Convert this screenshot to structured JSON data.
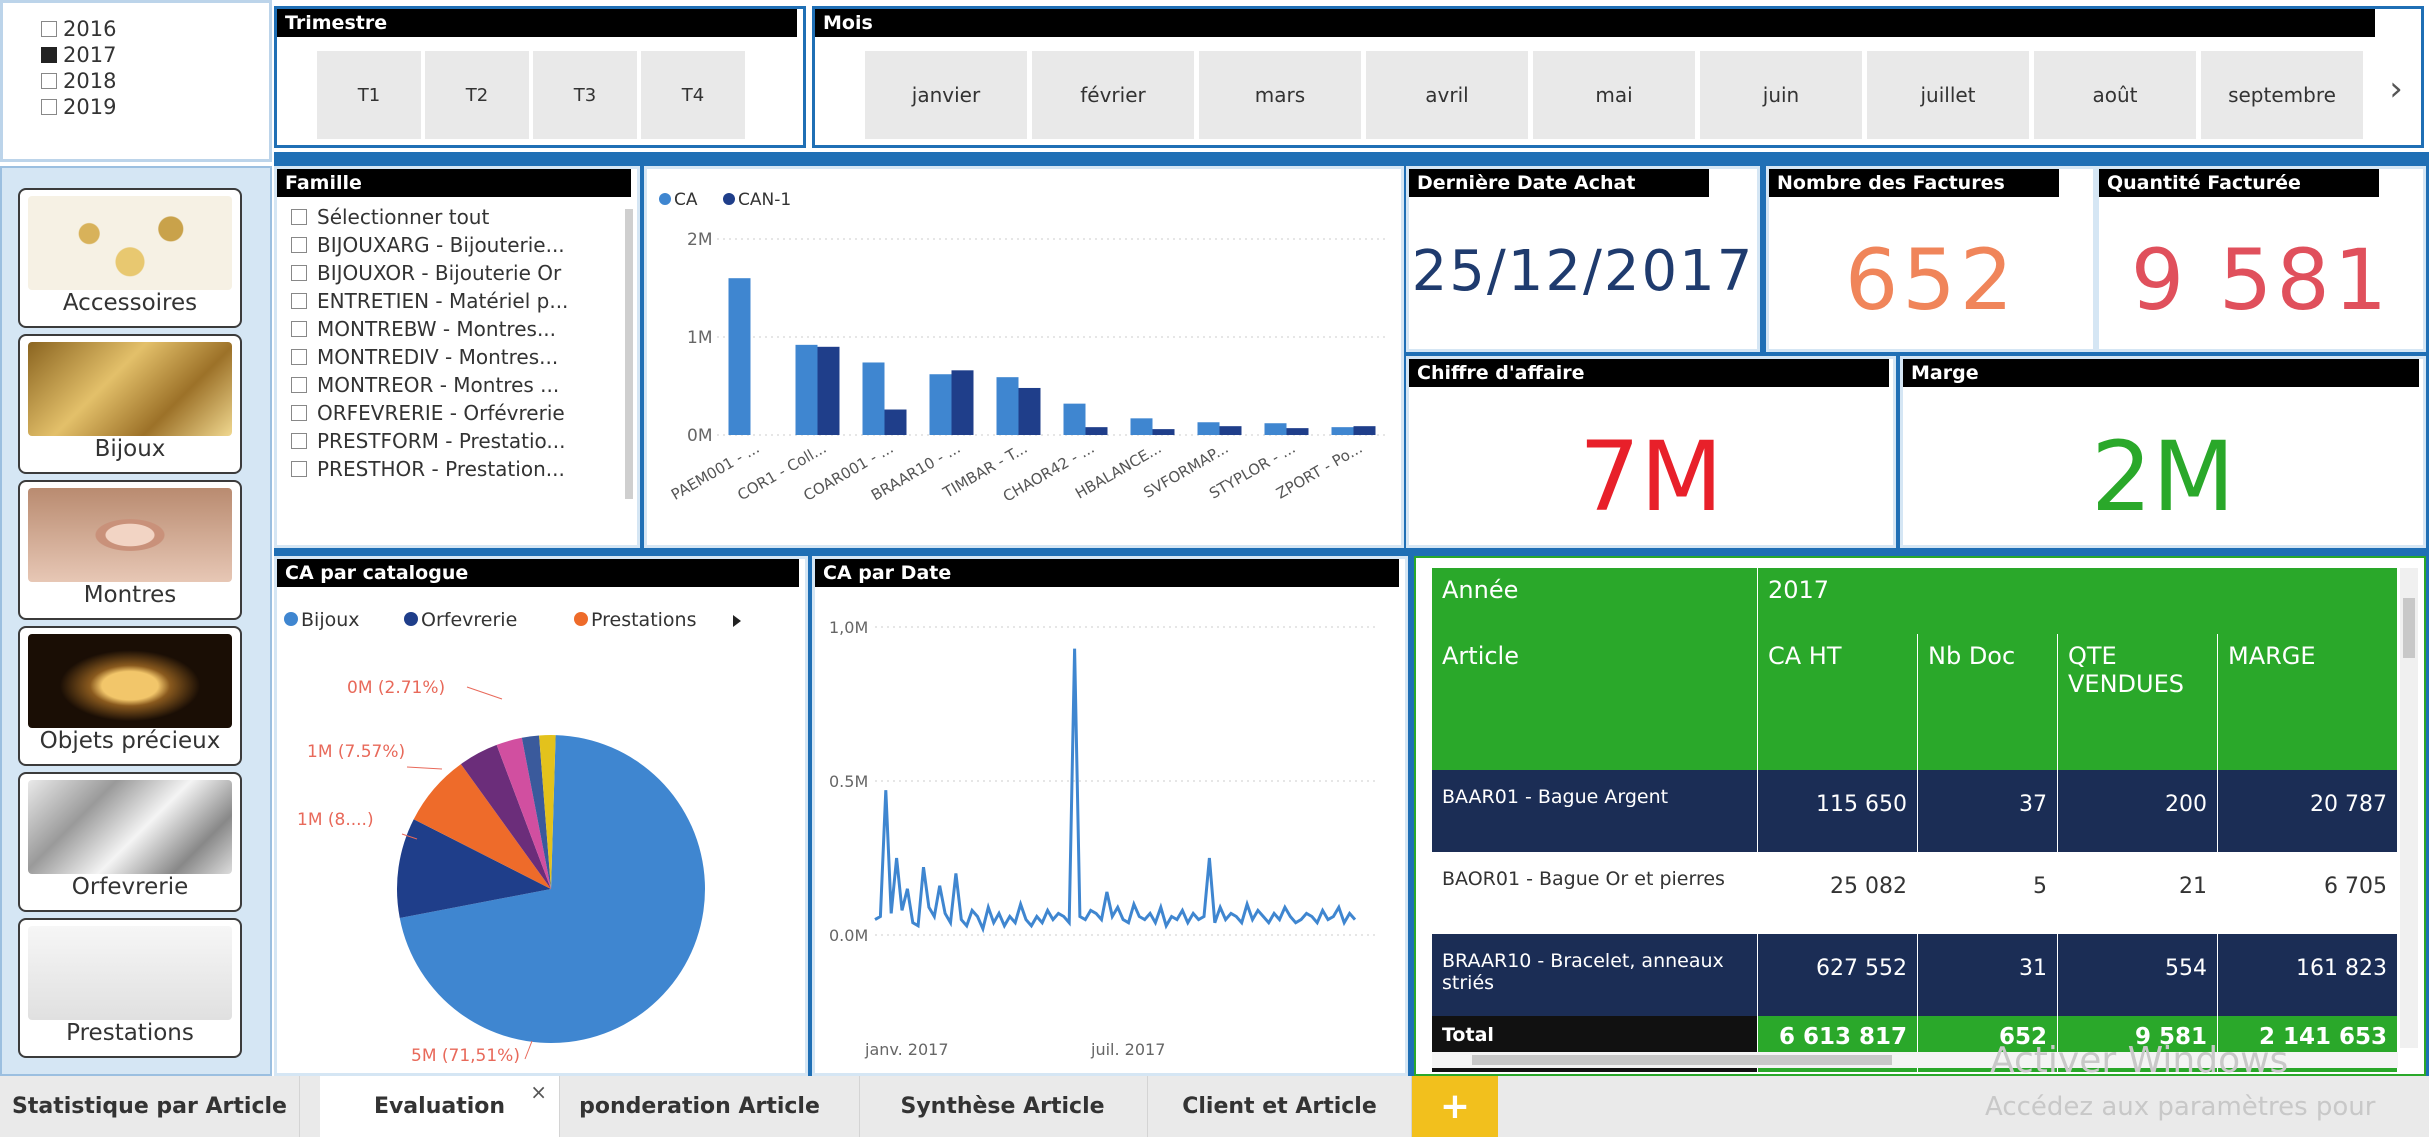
{
  "years": {
    "items": [
      {
        "label": "2016",
        "checked": false
      },
      {
        "label": "2017",
        "checked": true
      },
      {
        "label": "2018",
        "checked": false
      },
      {
        "label": "2019",
        "checked": false
      }
    ]
  },
  "trimestre": {
    "title": "Trimestre",
    "items": [
      "T1",
      "T2",
      "T3",
      "T4"
    ]
  },
  "mois": {
    "title": "Mois",
    "items": [
      "janvier",
      "février",
      "mars",
      "avril",
      "mai",
      "juin",
      "juillet",
      "août",
      "septembre"
    ],
    "next_icon": "chevron-right-icon"
  },
  "categories": [
    {
      "label": "Accessoires",
      "icon": "accessories-image"
    },
    {
      "label": "Bijoux",
      "icon": "jewelry-image"
    },
    {
      "label": "Montres",
      "icon": "watch-image"
    },
    {
      "label": "Objets précieux",
      "icon": "precious-objects-image"
    },
    {
      "label": "Orfevrerie",
      "icon": "silverware-image"
    },
    {
      "label": "Prestations",
      "icon": "services-image"
    }
  ],
  "famille": {
    "title": "Famille",
    "items": [
      "Sélectionner tout",
      "BIJOUXARG - Bijouterie...",
      "BIJOUXOR - Bijouterie Or",
      "ENTRETIEN - Matériel p...",
      "MONTREBW - Montres...",
      "MONTREDIV - Montres...",
      "MONTREOR - Montres ...",
      "ORFEVRERIE - Orfévrerie",
      "PRESTFORM - Prestatio...",
      "PRESTHOR - Prestation..."
    ]
  },
  "kpis": {
    "last_date": {
      "title": "Dernière Date Achat",
      "value": "25/12/2017",
      "color": "#1f3b6e"
    },
    "invoices": {
      "title": "Nombre des Factures",
      "value": "652",
      "color": "#f0855a"
    },
    "qty": {
      "title": "Quantité Facturée",
      "value": "9 581",
      "color": "#e0505c"
    },
    "revenue": {
      "title": "Chiffre d'affaire",
      "value": "7M",
      "color": "#e8202a"
    },
    "margin": {
      "title": "Marge",
      "value": "2M",
      "color": "#2aa82a"
    }
  },
  "chart_data": [
    {
      "type": "bar",
      "title": "",
      "legend": [
        "CA",
        "CAN-1"
      ],
      "colors": [
        "#3f86d0",
        "#1f3e8a"
      ],
      "yticks": [
        "2M",
        "1M",
        "0M"
      ],
      "ylim": [
        0,
        2000000
      ],
      "categories": [
        "PAEM001 - ...",
        "COR1 - Coll...",
        "COAR001 - ...",
        "BRAAR10 - ...",
        "TIMBAR - T...",
        "CHAOR42 - ...",
        "HBALANCE...",
        "SVFORMAP...",
        "STYPLOR - ...",
        "ZPORT - Po..."
      ],
      "series": [
        {
          "name": "CA",
          "values": [
            1600000,
            920000,
            740000,
            620000,
            590000,
            320000,
            170000,
            130000,
            120000,
            80000
          ]
        },
        {
          "name": "CAN-1",
          "values": [
            0,
            900000,
            260000,
            660000,
            480000,
            80000,
            60000,
            90000,
            70000,
            90000
          ]
        }
      ]
    },
    {
      "type": "pie",
      "title": "CA par catalogue",
      "legend": [
        "Bijoux",
        "Orfevrerie",
        "Prestations"
      ],
      "colors": [
        "#3f86d0",
        "#1f3e8a",
        "#ee6b2a",
        "#6b2d7a",
        "#d14fa0",
        "#3a5a9c",
        "#e3c21c"
      ],
      "values": [
        71.51,
        10.5,
        7.57,
        4.2,
        2.71,
        1.8,
        1.71
      ],
      "labels": [
        "5M (71,51%)",
        "1M (8....)",
        "1M (7.57%)",
        "0M (2.71%)"
      ]
    },
    {
      "type": "line",
      "title": "CA par Date",
      "yticks": [
        "1,0M",
        "0.5M",
        "0.0M"
      ],
      "ylim": [
        0,
        1000000
      ],
      "xticks": [
        "janv. 2017",
        "juil. 2017"
      ],
      "color": "#3f86d0",
      "values": [
        50000,
        60000,
        470000,
        70000,
        250000,
        80000,
        150000,
        40000,
        30000,
        220000,
        90000,
        60000,
        160000,
        70000,
        40000,
        200000,
        50000,
        30000,
        80000,
        60000,
        20000,
        90000,
        40000,
        70000,
        30000,
        60000,
        40000,
        100000,
        50000,
        30000,
        60000,
        40000,
        80000,
        50000,
        70000,
        60000,
        40000,
        930000,
        60000,
        50000,
        80000,
        70000,
        50000,
        140000,
        60000,
        90000,
        50000,
        40000,
        100000,
        60000,
        50000,
        70000,
        40000,
        90000,
        30000,
        60000,
        50000,
        80000,
        40000,
        70000,
        50000,
        60000,
        250000,
        40000,
        90000,
        50000,
        70000,
        60000,
        40000,
        100000,
        50000,
        80000,
        60000,
        40000,
        70000,
        50000,
        90000,
        60000,
        40000,
        50000,
        70000,
        60000,
        40000,
        80000,
        50000,
        60000,
        90000,
        40000,
        70000,
        50000
      ]
    }
  ],
  "table": {
    "year_label": "Année",
    "year_value": "2017",
    "headers": [
      "Article",
      "CA HT",
      "Nb Doc",
      "QTE VENDUES",
      "MARGE"
    ],
    "rows": [
      {
        "article": "BAAR01 - Bague Argent",
        "ca": "115 650",
        "nb": "37",
        "qte": "200",
        "marge": "20 787"
      },
      {
        "article": "BAOR01 - Bague Or et pierres",
        "ca": "25 082",
        "nb": "5",
        "qte": "21",
        "marge": "6 705"
      },
      {
        "article": "BRAAR10 - Bracelet, anneaux striés",
        "ca": "627 552",
        "nb": "31",
        "qte": "554",
        "marge": "161 823"
      }
    ],
    "total": {
      "article": "Total",
      "ca": "6 613 817",
      "nb": "652",
      "qte": "9 581",
      "marge": "2 141 653"
    }
  },
  "tabs": [
    {
      "label": "Statistique par Article",
      "active": false
    },
    {
      "label": "Evaluation",
      "active": true,
      "close": "×"
    },
    {
      "label": "ponderation Article",
      "active": false
    },
    {
      "label": "Synthèse Article",
      "active": false
    },
    {
      "label": "Client et Article",
      "active": false
    }
  ],
  "add_tab": "+",
  "watermark": {
    "line1": "Activer Windows",
    "line2": "Accédez aux paramètres pour"
  }
}
